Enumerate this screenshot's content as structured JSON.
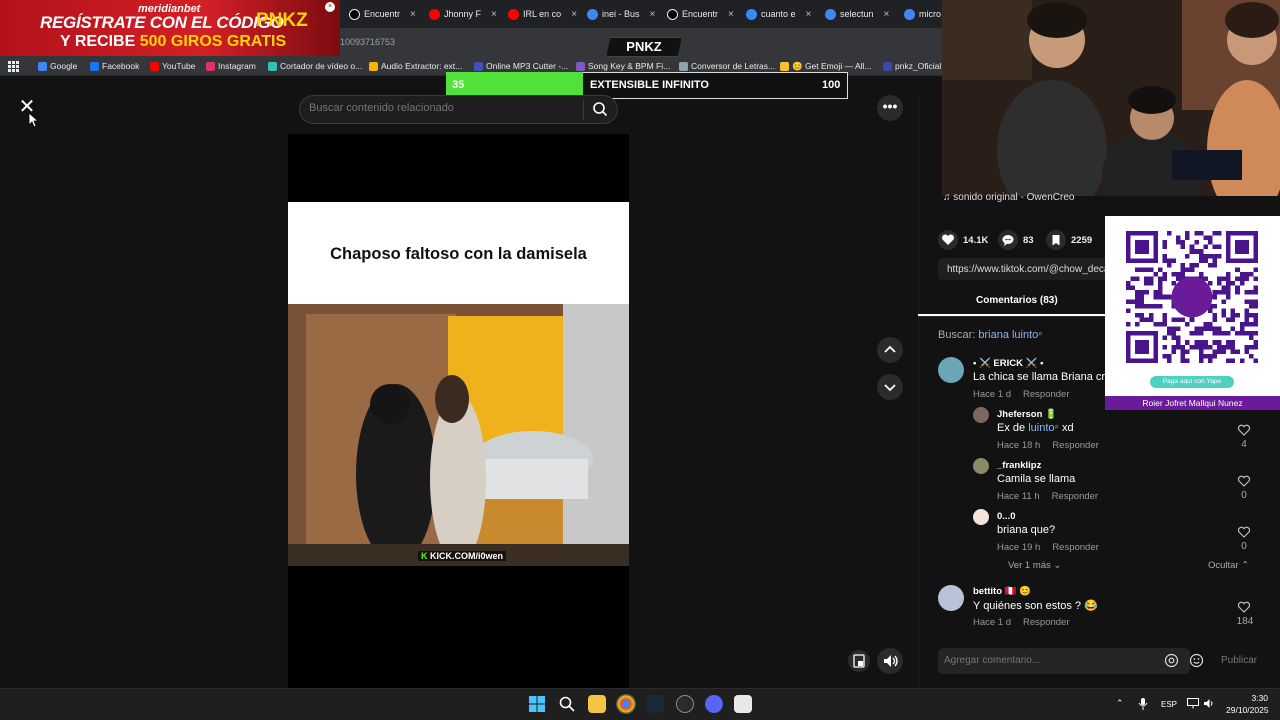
{
  "browser": {
    "tabs": [
      {
        "label": "Encuentr",
        "icon": "tiktok-icon",
        "color": "#000000"
      },
      {
        "label": "Jhonny F",
        "icon": "youtube-icon",
        "color": "#ff0000"
      },
      {
        "label": "IRL en co",
        "icon": "youtube-icon",
        "color": "#ff0000"
      },
      {
        "label": "inei - Bus",
        "icon": "google-icon",
        "color": "#4285f4"
      },
      {
        "label": "Encuentr",
        "icon": "tiktok-icon",
        "color": "#000000"
      },
      {
        "label": "cuanto e",
        "icon": "google-icon",
        "color": "#4285f4"
      },
      {
        "label": "selectun",
        "icon": "google-icon",
        "color": "#4285f4"
      },
      {
        "label": "micro",
        "icon": "google-icon",
        "color": "#4285f4"
      }
    ],
    "url_fragment": "10093716753",
    "bookmarks": [
      {
        "label": "Google",
        "color": "#4285f4"
      },
      {
        "label": "Facebook",
        "color": "#1877f2"
      },
      {
        "label": "YouTube",
        "color": "#ff0000"
      },
      {
        "label": "Instagram",
        "color": "#e1306c"
      },
      {
        "label": "Cortador de vídeo o...",
        "color": "#2ec4b6"
      },
      {
        "label": "Audio Extractor: ext...",
        "color": "#f4b400"
      },
      {
        "label": "Online MP3 Cutter -...",
        "color": "#3f51b5"
      },
      {
        "label": "Song Key & BPM Fi...",
        "color": "#7e57c2"
      },
      {
        "label": "Conversor de Letras...",
        "color": "#90a4ae"
      },
      {
        "label": "😊 Get Emoji — All...",
        "color": "#fbc02d"
      },
      {
        "label": "pnkz_Oficial",
        "color": "#3949ab"
      }
    ]
  },
  "ad": {
    "brand": "meridianbet",
    "line1": "REGÍSTRATE CON EL CÓDIGO",
    "code": "PNKZ",
    "line2_prefix": "Y RECIBE",
    "line2_highlight": "500 GIROS GRATIS"
  },
  "stream": {
    "logo": "PNKZ",
    "timer_left": "35",
    "timer_label": "EXTENSIBLE INFINITO",
    "timer_right": "100",
    "timer_fill_ratio": 0.34,
    "accent": "#52e03a"
  },
  "viewer": {
    "close_label": "✕",
    "search_placeholder": "Buscar contenido relacionado",
    "more_label": "•••",
    "video_caption": "Chaposo faltoso con la damisela",
    "watermark_prefix": "K",
    "watermark": "KICK.COM/i0wen"
  },
  "panel": {
    "sound": "♫  sonido original - OwenCreo",
    "likes": "14.1K",
    "comments_count": "83",
    "saves": "2259",
    "link": "https://www.tiktok.com/@chow_deca",
    "tab_comments": "Comentarios (83)",
    "search_prefix": "Buscar:",
    "search_term": "briana luinto",
    "comments": [
      {
        "name": "• ⚔️ ERICK ⚔️ •",
        "text": "La chica se llama Briana cre",
        "meta": "Hace 1 d",
        "reply": "Responder",
        "avatar": "#6aa5b8"
      },
      {
        "name": "Jheferson 🔋",
        "text_prefix": "Ex de",
        "text_mention": "luinto",
        "text_suffix": "xd",
        "meta": "Hace 18 h",
        "reply": "Responder",
        "likes": "4",
        "avatar": "#7b6a5c"
      },
      {
        "name": "_franklipz",
        "text": "Camila se llama",
        "meta": "Hace 11 h",
        "reply": "Responder",
        "likes": "0",
        "avatar": "#8a8a6a"
      },
      {
        "name": "0...0",
        "text": "briana que?",
        "meta": "Hace 19 h",
        "reply": "Responder",
        "likes": "0",
        "avatar": "#f3e3dc"
      },
      {
        "name": "bettito 🇵🇪 😊",
        "text": "Y quiénes son estos ? 😂",
        "meta": "Hace 1 d",
        "reply": "Responder",
        "likes": "184",
        "avatar": "#b9c2d6"
      }
    ],
    "more_replies": "Ver 1 más ⌄",
    "hide_replies": "Ocultar ⌃",
    "comment_placeholder": "Agregar comentario...",
    "publish": "Publicar"
  },
  "yape": {
    "pill": "Paga aquí con Yape",
    "name": "Roier Jofret Mallqui Nunez",
    "color": "#6a1b9a"
  },
  "taskbar": {
    "lang": "ESP",
    "time": "3:30",
    "date": "29/10/2025"
  }
}
